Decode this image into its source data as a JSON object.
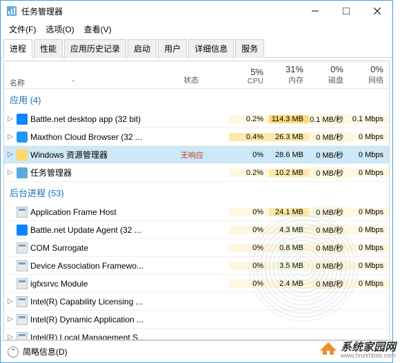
{
  "window": {
    "title": "任务管理器"
  },
  "menu": {
    "file": "文件(F)",
    "options": "选项(O)",
    "view": "查看(V)"
  },
  "tabs": {
    "processes": "进程",
    "performance": "性能",
    "app_history": "应用历史记录",
    "startup": "启动",
    "users": "用户",
    "details": "详细信息",
    "services": "服务"
  },
  "columns": {
    "name": "名称",
    "status": "状态",
    "cpu_pct": "5%",
    "cpu_lbl": "CPU",
    "mem_pct": "31%",
    "mem_lbl": "内存",
    "disk_pct": "0%",
    "disk_lbl": "磁盘",
    "net_pct": "0%",
    "net_lbl": "网络"
  },
  "groups": {
    "apps": "应用 (4)",
    "bg": "后台进程 (53)"
  },
  "rows": {
    "app0": {
      "name": "Battle.net desktop app (32 bit)",
      "status": "",
      "cpu": "0.2%",
      "mem": "114.3 MB",
      "disk": "0.1 MB/秒",
      "net": "0.1 Mbps"
    },
    "app1": {
      "name": "Maxthon Cloud Browser (32 ...",
      "status": "",
      "cpu": "0.4%",
      "mem": "26.3 MB",
      "disk": "0 MB/秒",
      "net": "0 Mbps"
    },
    "app2": {
      "name": "Windows 资源管理器",
      "status": "无响应",
      "cpu": "0%",
      "mem": "28.6 MB",
      "disk": "0 MB/秒",
      "net": "0 Mbps"
    },
    "app3": {
      "name": "任务管理器",
      "status": "",
      "cpu": "0.2%",
      "mem": "10.2 MB",
      "disk": "0 MB/秒",
      "net": "0 Mbps"
    },
    "bg0": {
      "name": "Application Frame Host",
      "cpu": "0%",
      "mem": "24.1 MB",
      "disk": "0 MB/秒",
      "net": "0 Mbps"
    },
    "bg1": {
      "name": "Battle.net Update Agent (32 ...",
      "cpu": "0%",
      "mem": "4.3 MB",
      "disk": "0 MB/秒",
      "net": "0 Mbps"
    },
    "bg2": {
      "name": "COM Surrogate",
      "cpu": "0%",
      "mem": "0.8 MB",
      "disk": "0 MB/秒",
      "net": "0 Mbps"
    },
    "bg3": {
      "name": "Device Association Framewo...",
      "cpu": "0%",
      "mem": "3.5 MB",
      "disk": "0 MB/秒",
      "net": "0 Mbps"
    },
    "bg4": {
      "name": "igfxsrvc Module",
      "cpu": "0%",
      "mem": "2.4 MB",
      "disk": "0 MB/秒",
      "net": "0 Mbps"
    },
    "bg5": {
      "name": "Intel(R) Capability Licensing ...",
      "cpu": "",
      "mem": "",
      "disk": "",
      "net": ""
    },
    "bg6": {
      "name": "Intel(R) Dynamic Application ...",
      "cpu": "",
      "mem": "",
      "disk": "",
      "net": ""
    },
    "bg7": {
      "name": "Intel(R) Local Management S...",
      "cpu": "",
      "mem": "",
      "disk": "",
      "net": ""
    }
  },
  "footer": {
    "fewer_details": "简略信息(D)"
  },
  "watermark": {
    "text": "系统家园网",
    "url": "www.hnzkhbsb.com"
  }
}
